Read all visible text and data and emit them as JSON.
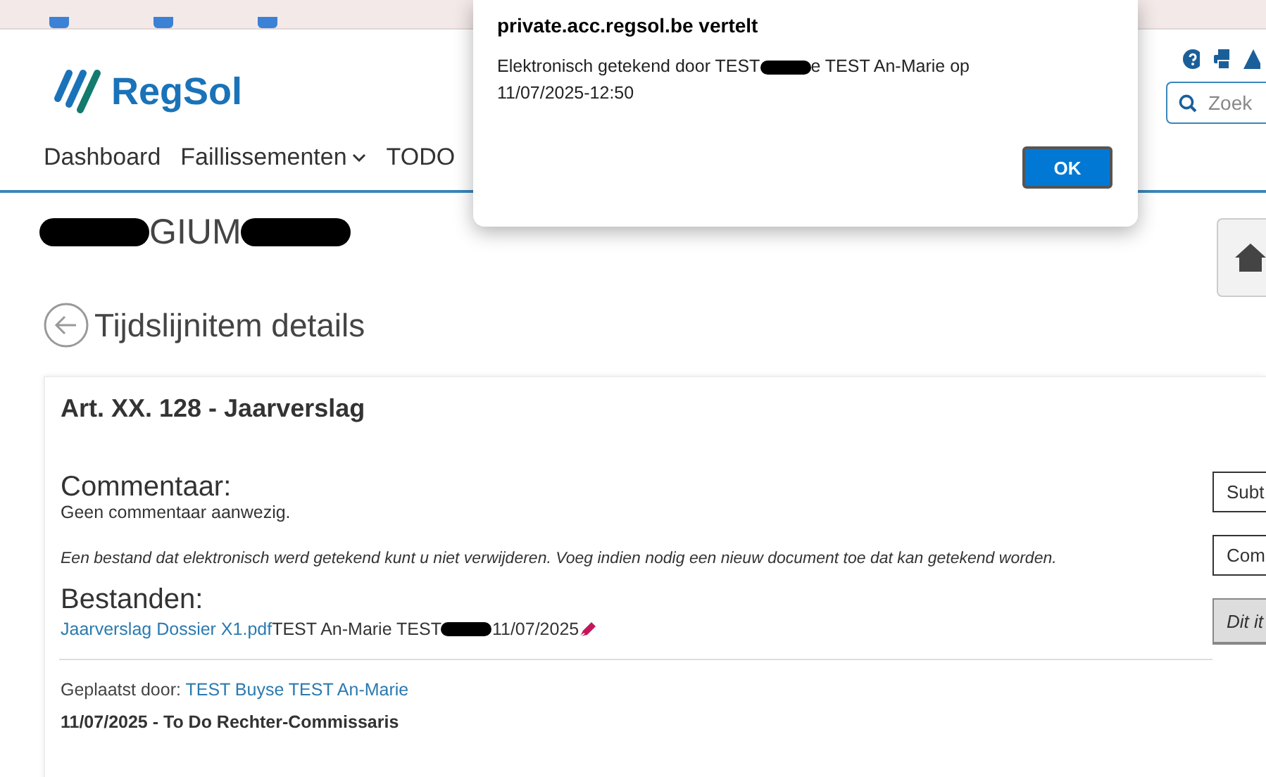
{
  "header": {
    "logo": "RegSol",
    "nav": [
      {
        "label": "Dashboard",
        "dropdown": false
      },
      {
        "label": "Faillissementen",
        "dropdown": true
      },
      {
        "label": "TODO",
        "dropdown": false
      }
    ],
    "search": {
      "placeholder": "Zoek"
    }
  },
  "page_heading": [
    {
      "kind": "redacted"
    },
    {
      "kind": "text",
      "text": "GIUM"
    },
    {
      "kind": "redacted"
    }
  ],
  "subtitle": "Tijdslijnitem details",
  "card": {
    "title": "Art. XX. 128 - Jaarverslag",
    "comment_label": "Commentaar:",
    "comment_text": "Geen commentaar aanwezig.",
    "notice": "Een bestand dat elektronisch werd getekend kunt u niet verwijderen. Voeg indien nodig een nieuw document toe dat kan getekend worden.",
    "files_label": "Bestanden:",
    "files": [
      {
        "name": "Jaarverslag Dossier X1.pdf",
        "info": [
          {
            "kind": "text",
            "text": "TEST An-Marie TEST"
          },
          {
            "kind": "redacted"
          },
          {
            "kind": "text",
            "text": "11/07/2025"
          }
        ],
        "signed": true
      }
    ],
    "posted_by_label": "Geplaatst door:",
    "posted_by": "TEST Buyse TEST An-Marie",
    "footer": "11/07/2025 - To Do Rechter-Commissaris",
    "actions": [
      {
        "label": "Subt",
        "kind": "button"
      },
      {
        "label": "Com",
        "kind": "button"
      },
      {
        "label": "Dit it",
        "kind": "note"
      }
    ]
  },
  "dialog": {
    "title": "private.acc.regsol.be vertelt",
    "message": [
      [
        {
          "kind": "text",
          "text": "Elektronisch getekend door TEST"
        },
        {
          "kind": "redacted"
        },
        {
          "kind": "text",
          "text": "e TEST An-Marie op"
        }
      ],
      [
        {
          "kind": "text",
          "text": "11/07/2025-12:50"
        }
      ]
    ],
    "button": "OK"
  }
}
